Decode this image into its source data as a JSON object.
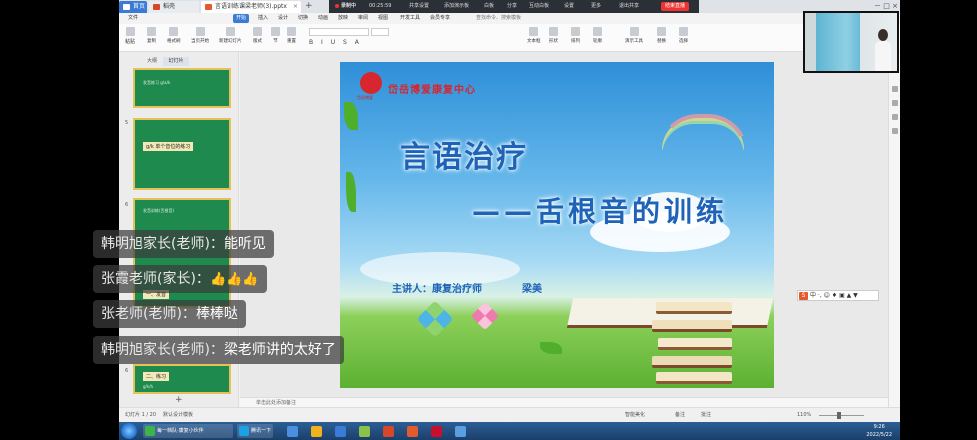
{
  "window": {
    "tabs": [
      {
        "label": "首页"
      },
      {
        "label": "稻壳"
      },
      {
        "label": "言语训练课梁老师(3).pptx"
      }
    ],
    "new_tab": "+"
  },
  "recording": {
    "status": "录制中",
    "time": "00:25:59",
    "items": [
      "共享设置",
      "添加演示板",
      "白板",
      "分享",
      "互动白板",
      "设置",
      "更多"
    ],
    "exit_label": "退出共享",
    "end_label": "结束直播"
  },
  "menu": {
    "items": [
      "文件",
      "开始",
      "插入",
      "设计",
      "切换",
      "动画",
      "放映",
      "审阅",
      "视图",
      "开发工具",
      "会员专享"
    ],
    "active_index": 1,
    "search_placeholder": "查找命令、搜索模板"
  },
  "ribbon": {
    "items": [
      "粘贴",
      "复制",
      "格式刷",
      "当页开始",
      "新建幻灯片",
      "版式",
      "节",
      "重置",
      "文本框",
      "形状",
      "排列",
      "轮廓",
      "演示工具",
      "替换",
      "选择"
    ]
  },
  "panel": {
    "tabs": [
      "大纲",
      "幻灯片"
    ],
    "thumbs": [
      {
        "num": "",
        "title": "",
        "line": "发音练习  g/a/k"
      },
      {
        "num": "5",
        "title": "g/k 单个音位的练习",
        "line": ""
      },
      {
        "num": "6",
        "title": "一、发音",
        "line": "发音训练(舌根音)"
      },
      {
        "num": "6",
        "title": "二、练习",
        "line": "g/k/h"
      }
    ],
    "add": "+"
  },
  "slide": {
    "org": "岱岳博爱康复中心",
    "logo_sub": "岱岳博爱",
    "title": "言语治疗",
    "subtitle": "——舌根音的训练",
    "presenter": "主讲人：康复治疗师",
    "name": "梁美"
  },
  "notes": {
    "placeholder": "单击此处添加备注"
  },
  "status": {
    "slide_count": "幻灯片 1 / 20",
    "theme": "默认设计模板",
    "beautify": "智能美化",
    "notes_btn": "备注",
    "comment_btn": "批注",
    "zoom": "110%"
  },
  "ime": {
    "logo": "S",
    "text": "中 ·, ☺ ♦ ▣ ▲ ▼"
  },
  "chat": [
    {
      "name": "韩明旭家长(老师)：",
      "message": "能听见"
    },
    {
      "name": "张霞老师(家长)：",
      "message": "",
      "thumbs": "👍👍👍"
    },
    {
      "name": "张老师(老师)：",
      "message": "棒棒哒"
    },
    {
      "name": "韩明旭家长(老师)：",
      "message": "梁老师讲的太好了"
    }
  ],
  "taskbar": {
    "tasks": [
      "每一档队·康复小伙伴",
      "腾讯一下"
    ],
    "time": "9:26",
    "date": "2022/5/22"
  },
  "colors": {
    "accent": "#3a7bd5",
    "slide_title": "#1e63b7",
    "org_red": "#d8262e",
    "record_red": "#e33333"
  }
}
